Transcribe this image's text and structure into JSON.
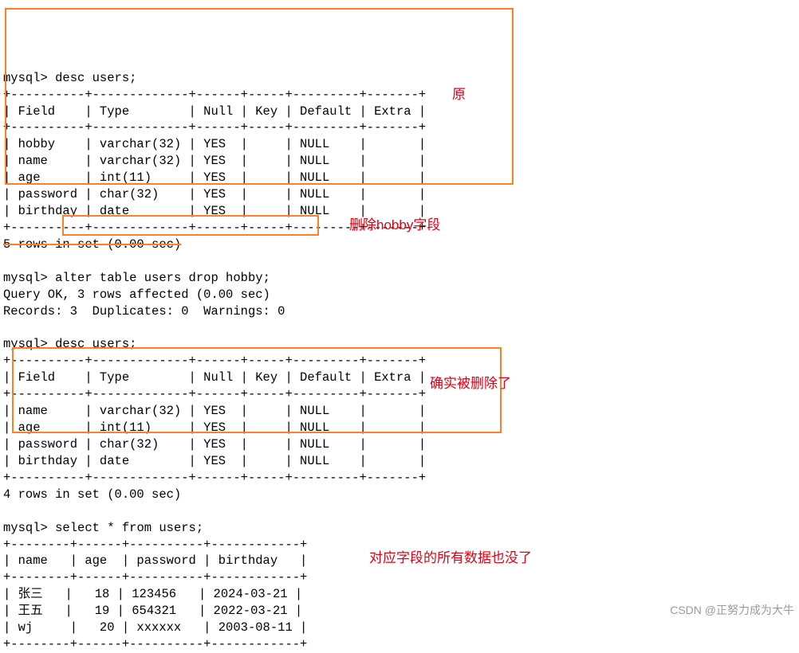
{
  "prompt": "mysql>",
  "cmds": {
    "desc1_cmd": "desc users;",
    "alter_cmd": "alter table users drop hobby;",
    "desc2_cmd": "desc users;",
    "select_cmd": "select * from users;"
  },
  "desc_table1": {
    "border": "+----------+-------------+------+-----+---------+-------+",
    "header": "| Field    | Type        | Null | Key | Default | Extra |",
    "border_mid": "+----------+-------------+------+-----+---------+-------+",
    "rows": [
      "| hobby    | varchar(32) | YES  |     | NULL    |       |",
      "| name     | varchar(32) | YES  |     | NULL    |       |",
      "| age      | int(11)     | YES  |     | NULL    |       |",
      "| password | char(32)    | YES  |     | NULL    |       |",
      "| birthday | date        | YES  |     | NULL    |       |"
    ],
    "border_end": "+----------+-------------+------+-----+---------+-------+"
  },
  "rows_in_set_1": "5 rows in set (0.00 sec)",
  "alter_result": {
    "line1": "Query OK, 3 rows affected (0.00 sec)",
    "line2": "Records: 3  Duplicates: 0  Warnings: 0"
  },
  "desc_table2": {
    "border": "+----------+-------------+------+-----+---------+-------+",
    "header": "| Field    | Type        | Null | Key | Default | Extra |",
    "border_mid": "+----------+-------------+------+-----+---------+-------+",
    "rows": [
      "| name     | varchar(32) | YES  |     | NULL    |       |",
      "| age      | int(11)     | YES  |     | NULL    |       |",
      "| password | char(32)    | YES  |     | NULL    |       |",
      "| birthday | date        | YES  |     | NULL    |       |"
    ],
    "border_end": "+----------+-------------+------+-----+---------+-------+"
  },
  "rows_in_set_2": "4 rows in set (0.00 sec)",
  "select_table": {
    "border": "+--------+------+----------+------------+",
    "header": "| name   | age  | password | birthday   |",
    "border_mid": "+--------+------+----------+------------+",
    "r1a": "| ",
    "r1_name": "张三",
    "r1b": "   |   18 | 123456   | 2024-03-21 |",
    "r2a": "| ",
    "r2_name": "王五",
    "r2b": "   |   19 | 654321   | 2022-03-21 |",
    "r3": "| wj     |   20 | xxxxxx   | 2003-08-11 |",
    "border_end": "+--------+------+----------+------------+"
  },
  "notes": {
    "note1": "原",
    "note2": "删除hobby字段",
    "note3": "确实被删除了",
    "note4": "对应字段的所有数据也没了"
  },
  "watermark": "CSDN @正努力成为大牛"
}
